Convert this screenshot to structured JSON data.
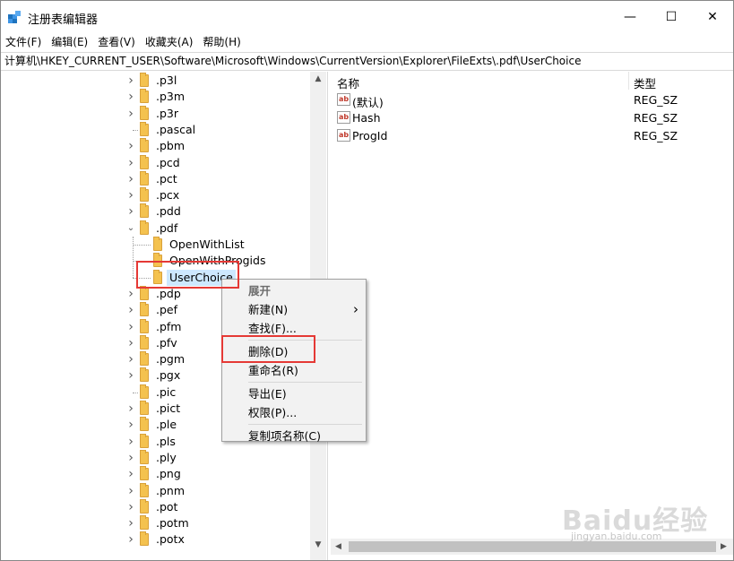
{
  "window": {
    "title": "注册表编辑器",
    "controls": {
      "minimize": "—",
      "maximize": "☐",
      "close": "✕"
    }
  },
  "menubar": [
    "文件(F)",
    "编辑(E)",
    "查看(V)",
    "收藏夹(A)",
    "帮助(H)"
  ],
  "address": "计算机\\HKEY_CURRENT_USER\\Software\\Microsoft\\Windows\\CurrentVersion\\Explorer\\FileExts\\.pdf\\UserChoice",
  "tree": {
    "items": [
      {
        "label": ".p3l",
        "expandable": true
      },
      {
        "label": ".p3m",
        "expandable": true
      },
      {
        "label": ".p3r",
        "expandable": true
      },
      {
        "label": ".pascal",
        "expandable": false
      },
      {
        "label": ".pbm",
        "expandable": true
      },
      {
        "label": ".pcd",
        "expandable": true
      },
      {
        "label": ".pct",
        "expandable": true
      },
      {
        "label": ".pcx",
        "expandable": true
      },
      {
        "label": ".pdd",
        "expandable": true
      },
      {
        "label": ".pdf",
        "expandable": true,
        "expanded": true
      },
      {
        "label": "OpenWithList",
        "child": true
      },
      {
        "label": "OpenWithProgids",
        "child": true
      },
      {
        "label": "UserChoice",
        "child": true,
        "selected": true
      },
      {
        "label": ".pdp",
        "expandable": true
      },
      {
        "label": ".pef",
        "expandable": true
      },
      {
        "label": ".pfm",
        "expandable": true
      },
      {
        "label": ".pfv",
        "expandable": true
      },
      {
        "label": ".pgm",
        "expandable": true
      },
      {
        "label": ".pgx",
        "expandable": true
      },
      {
        "label": ".pic",
        "expandable": false
      },
      {
        "label": ".pict",
        "expandable": true
      },
      {
        "label": ".ple",
        "expandable": true
      },
      {
        "label": ".pls",
        "expandable": true
      },
      {
        "label": ".ply",
        "expandable": true
      },
      {
        "label": ".png",
        "expandable": true
      },
      {
        "label": ".pnm",
        "expandable": true
      },
      {
        "label": ".pot",
        "expandable": true
      },
      {
        "label": ".potm",
        "expandable": true
      },
      {
        "label": ".potx",
        "expandable": true
      }
    ]
  },
  "list": {
    "columns": {
      "name": "名称",
      "type": "类型"
    },
    "rows": [
      {
        "name": "(默认)",
        "type": "REG_SZ"
      },
      {
        "name": "Hash",
        "type": "REG_SZ"
      },
      {
        "name": "ProgId",
        "type": "REG_SZ"
      }
    ]
  },
  "context_menu": {
    "items": [
      {
        "label": "展开",
        "disabled": true
      },
      {
        "label": "新建(N)",
        "submenu": true
      },
      {
        "label": "查找(F)..."
      },
      {
        "sep": true
      },
      {
        "label": "删除(D)"
      },
      {
        "label": "重命名(R)"
      },
      {
        "sep": true
      },
      {
        "label": "导出(E)"
      },
      {
        "label": "权限(P)..."
      },
      {
        "sep": true
      },
      {
        "label": "复制项名称(C)"
      }
    ]
  },
  "watermark": {
    "logo": "Baidu经验",
    "url": "jingyan.baidu.com"
  },
  "colors": {
    "highlight": "#e53935",
    "selection": "#cde8ff",
    "folder": "#f4c24f"
  }
}
